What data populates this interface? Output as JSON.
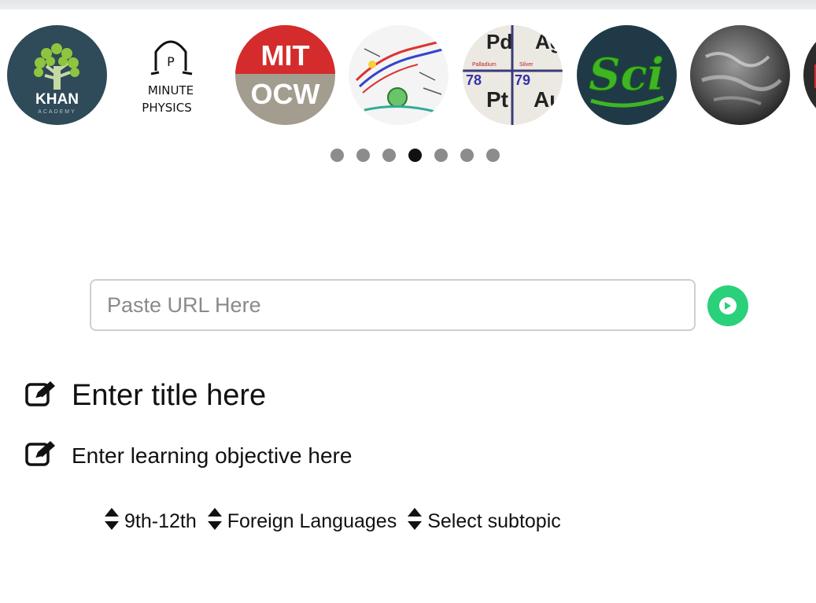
{
  "carousel": {
    "channels": [
      {
        "name": "Khan Academy",
        "logo_text": "KHAN",
        "logo_subtext": "ACADEMY",
        "icon": "khan-tree-icon"
      },
      {
        "name": "MinutePhysics",
        "logo_text": "MINUTE",
        "logo_subtext": "PHYSICS",
        "icon": "minutephysics-icon"
      },
      {
        "name": "MIT OCW",
        "logo_text": "MIT",
        "logo_subtext": "OCW",
        "icon": "mit-ocw-icon"
      },
      {
        "name": "Biology diagram",
        "icon": "cell-diagram-icon"
      },
      {
        "name": "Periodic table",
        "icon": "periodic-table-icon",
        "cells": [
          {
            "symbol": "Pd",
            "number": "",
            "name": "Palladium"
          },
          {
            "symbol": "Ag",
            "number": "",
            "name": "Silver"
          },
          {
            "symbol": "Pt",
            "number": "78",
            "name": ""
          },
          {
            "symbol": "Au",
            "number": "79",
            "name": ""
          }
        ]
      },
      {
        "name": "SciShow",
        "logo_text": "Sci",
        "icon": "scishow-icon"
      },
      {
        "name": "Earth view",
        "icon": "earth-icon"
      },
      {
        "name": "More channel",
        "icon": "partial-channel-icon"
      }
    ],
    "page_count": 7,
    "active_page_index": 3
  },
  "url_input": {
    "placeholder": "Paste URL Here",
    "value": ""
  },
  "go_button": {
    "icon": "play-circle-icon",
    "color": "#2bd07b"
  },
  "title": {
    "text": "Enter title here",
    "icon": "edit-icon"
  },
  "objective": {
    "text": "Enter learning objective here",
    "icon": "edit-icon"
  },
  "selects": {
    "grade": "9th-12th",
    "subject": "Foreign Languages",
    "subtopic": "Select subtopic"
  }
}
